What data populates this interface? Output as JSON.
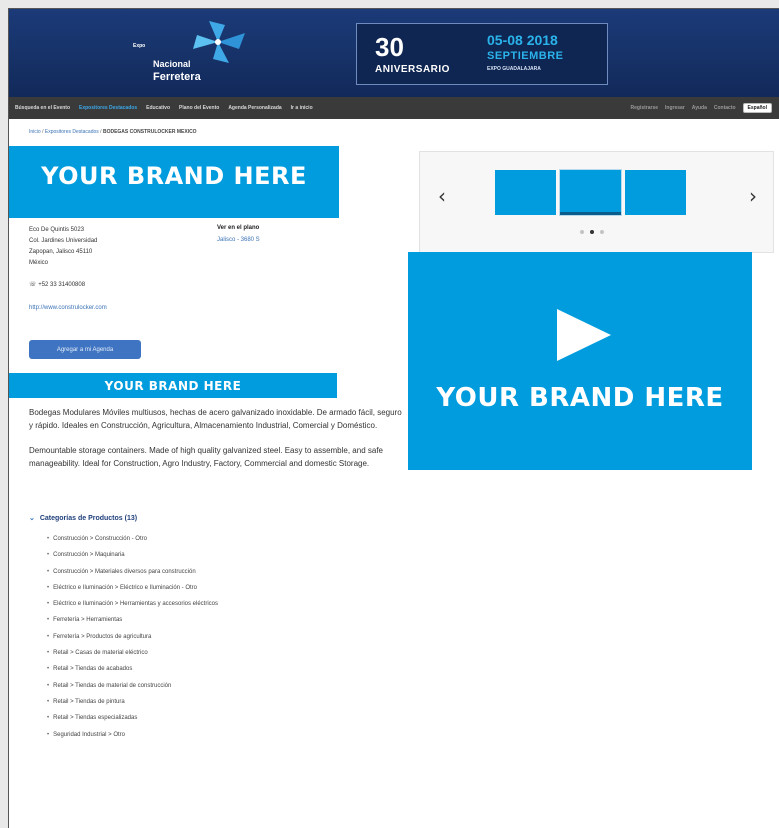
{
  "header": {
    "logo_small": "Expo",
    "logo_line1": "Nacional",
    "logo_line2": "Ferretera",
    "banner": {
      "number": "30",
      "aniversario": "ANIVERSARIO",
      "dates": "05-08 2018",
      "month": "SEPTIEMBRE",
      "venue": "EXPO GUADALAJARA"
    }
  },
  "nav": {
    "items": [
      {
        "label": "Búsqueda en el Evento"
      },
      {
        "label": "Expositores Destacados"
      },
      {
        "label": "Educativo"
      },
      {
        "label": "Plano del Evento"
      },
      {
        "label": "Agenda Personalizada"
      },
      {
        "label": "Ir a inicio"
      }
    ],
    "right_items": [
      {
        "label": "Registrarse"
      },
      {
        "label": "Ingresar"
      },
      {
        "label": "Ayuda"
      },
      {
        "label": "Contacto"
      }
    ],
    "language": "Español"
  },
  "breadcrumb": {
    "home": "Inicio",
    "section": "Expositores Destacados",
    "current": "BODEGAS CONSTRULOCKER MEXICO"
  },
  "brand": {
    "top": "YOUR BRAND HERE",
    "mid": "YOUR BRAND HERE",
    "video": "YOUR BRAND HERE"
  },
  "contact": {
    "address_1": "Eco De Quintis 5023",
    "address_2": "Col. Jardines Universidad",
    "address_3": "Zapopan, Jalisco 45110",
    "address_4": "México",
    "phone": "+52 33 31400808",
    "website": "http://www.construlocker.com",
    "map_label": "Ver en el plano",
    "map_link": "Jalisco - 3680 S",
    "agenda_button": "Agregar a mi Agenda"
  },
  "description": {
    "spanish": "Bodegas Modulares Móviles multiusos, hechas de acero galvanizado inoxidable. De armado fácil, seguro y rápido. Ideales en Construcción, Agricultura, Almacenamiento Industrial, Comercial y Doméstico.",
    "english": "Demountable storage containers. Made of high quality galvanized steel. Easy to assemble, and safe manageability. Ideal for Construction, Agro Industry, Factory, Commercial and domestic Storage."
  },
  "categories": {
    "heading": "Categorías de Productos (13)",
    "items": [
      "Construcción > Construcción - Otro",
      "Construcción > Maquinaria",
      "Construcción > Materiales diversos para construcción",
      "Eléctrico e Iluminación > Eléctrico e Iluminación - Otro",
      "Eléctrico e Iluminación > Herramientas y accesorios eléctricos",
      "Ferretería > Herramientas",
      "Ferretería > Productos de agricultura",
      "Retail > Casas de material eléctrico",
      "Retail > Tiendas de acabados",
      "Retail > Tiendas de material de construcción",
      "Retail > Tiendas de pintura",
      "Retail > Tiendas especializadas",
      "Seguridad Industrial > Otro"
    ]
  },
  "gallery": {
    "prev_icon": "chevron-left-icon",
    "next_icon": "chevron-right-icon",
    "prev_glyph": "‹",
    "next_glyph": "›",
    "thumb_count": 3,
    "selected_thumb": 2,
    "dot_count": 3,
    "active_dot": 2
  },
  "colors": {
    "brand_blue": "#009cde",
    "header_navy": "#163166",
    "nav_bg": "#3a3a3a",
    "accent_cyan": "#2ab3ea",
    "link_blue": "#3b72b5"
  }
}
